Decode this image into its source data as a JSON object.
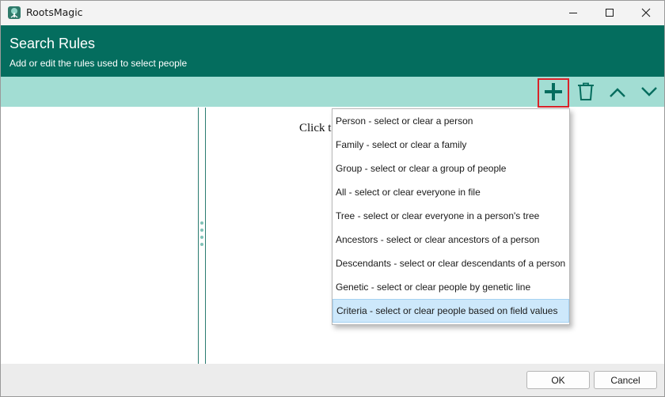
{
  "window": {
    "title": "RootsMagic",
    "controls": {
      "minimize": "minimize-icon",
      "maximize": "maximize-icon",
      "close": "close-icon"
    }
  },
  "header": {
    "title": "Search Rules",
    "subtitle": "Add or edit the rules used to select people",
    "color": "#046d5e"
  },
  "toolbar": {
    "color": "#a2ddd3",
    "icons": [
      "plus-icon",
      "trash-icon",
      "chevron-up-icon",
      "chevron-down-icon"
    ]
  },
  "main": {
    "hint": "Click t"
  },
  "menu": {
    "items": [
      {
        "label": "Person - select or clear a person"
      },
      {
        "label": "Family - select or clear a family"
      },
      {
        "label": "Group - select or clear a group of people"
      },
      {
        "label": "All - select or clear everyone in file"
      },
      {
        "label": "Tree - select or clear everyone in a person's tree"
      },
      {
        "label": "Ancestors - select or clear ancestors of a person"
      },
      {
        "label": "Descendants - select or clear descendants of a person"
      },
      {
        "label": "Genetic - select or clear people by genetic line"
      },
      {
        "label": "Criteria - select or clear people based on field values"
      }
    ],
    "highlighted_item": "Criteria - select or clear people based on field values"
  },
  "footer": {
    "ok_label": "OK",
    "cancel_label": "Cancel"
  }
}
